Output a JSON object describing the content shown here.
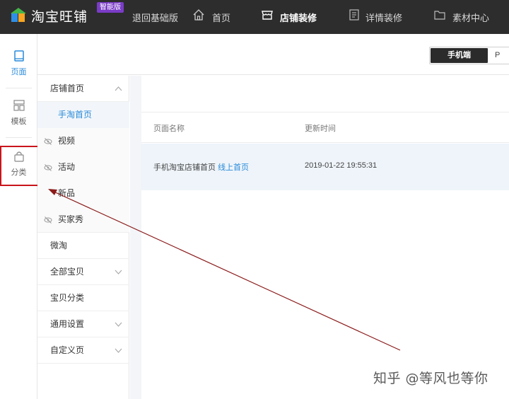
{
  "topbar": {
    "brand": "淘宝旺铺",
    "badge": "智能版",
    "links": {
      "back_basic": "退回基础版",
      "home": "首页",
      "decoration": "店铺装修",
      "detail": "详情装修",
      "material": "素材中心"
    }
  },
  "rail": {
    "page": "页面",
    "template": "模板",
    "category": "分类"
  },
  "device": {
    "mobile": "手机端",
    "pc": "P"
  },
  "subnav": {
    "shop_home": "店铺首页",
    "mobile_home": "手淘首页",
    "video": "视频",
    "activity": "活动",
    "new": "新品",
    "buyer_show": "买家秀",
    "weitao": "微淘",
    "all_items": "全部宝贝",
    "item_category": "宝贝分类",
    "common_settings": "通用设置",
    "custom_page": "自定义页"
  },
  "table": {
    "col_name": "页面名称",
    "col_time": "更新时间",
    "row_name": "手机淘宝店铺首页",
    "row_status": "线上首页",
    "row_time": "2019-01-22 19:55:31"
  },
  "watermark": "知乎 @等风也等你",
  "colors": {
    "topbar": "#2d2d2d",
    "accent": "#2a8ad8",
    "badge": "#7a3cc7",
    "highlight": "#c9141c",
    "arrow": "#8b1a1a"
  }
}
